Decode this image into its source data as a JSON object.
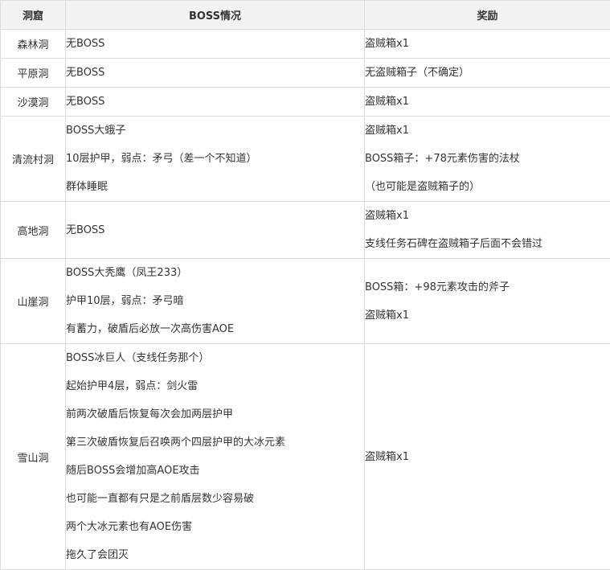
{
  "table": {
    "headers": [
      "洞窟",
      "BOSS情况",
      "奖励"
    ],
    "rows": [
      {
        "cave": "森林洞",
        "boss": [
          "无BOSS"
        ],
        "reward": [
          "盗贼箱x1"
        ]
      },
      {
        "cave": "平原洞",
        "boss": [
          "无BOSS"
        ],
        "reward": [
          "无盗贼箱子（不确定）"
        ]
      },
      {
        "cave": "沙漠洞",
        "boss": [
          "无BOSS"
        ],
        "reward": [
          "盗贼箱x1"
        ]
      },
      {
        "cave": "清流村洞",
        "boss": [
          "BOSS大蛾子",
          "10层护甲，弱点：矛弓（差一个不知道）",
          "群体睡眠"
        ],
        "reward": [
          "盗贼箱x1",
          "BOSS箱子：+78元素伤害的法杖",
          "（也可能是盗贼箱子的）"
        ]
      },
      {
        "cave": "高地洞",
        "boss": [
          "无BOSS"
        ],
        "reward": [
          "盗贼箱x1",
          "支线任务石碑在盗贼箱子后面不会错过"
        ]
      },
      {
        "cave": "山崖洞",
        "boss": [
          "BOSS大秃鹰（凤王233）",
          "护甲10层，弱点：矛弓暗",
          "有蓄力，破盾后必放一次高伤害AOE"
        ],
        "reward": [
          "BOSS箱：+98元素攻击的斧子",
          "盗贼箱x1"
        ]
      },
      {
        "cave": "雪山洞",
        "boss": [
          "BOSS冰巨人（支线任务那个）",
          "起始护甲4层，弱点：剑火雷",
          "前两次破盾后恢复每次会加两层护甲",
          "第三次破盾恢复后召唤两个四层护甲的大冰元素",
          "随后BOSS会增加高AOE攻击",
          "也可能一直都有只是之前盾层数少容易破",
          "两个大冰元素也有AOE伤害",
          "拖久了会团灭"
        ],
        "reward": [
          "盗贼箱x1"
        ]
      }
    ]
  }
}
